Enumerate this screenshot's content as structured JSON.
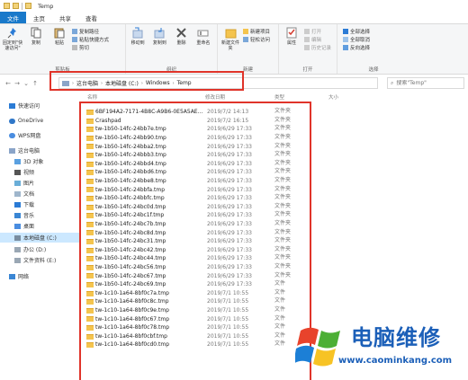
{
  "window": {
    "title": "Temp"
  },
  "tabs": [
    "文件",
    "主页",
    "共享",
    "查看"
  ],
  "ribbon": {
    "clipboard": {
      "pin": "固定到\"快速访问\"",
      "copy": "复制",
      "paste": "粘贴",
      "copy_path": "复制路径",
      "paste_shortcut": "粘贴快捷方式",
      "cut": "剪切",
      "label": "剪贴板"
    },
    "organize": {
      "move_to": "移动到",
      "copy_to": "复制到",
      "delete": "删除",
      "rename": "重命名",
      "label": "组织"
    },
    "new": {
      "new_folder": "新建文件夹",
      "new_item": "新建项目",
      "easy_access": "轻松访问",
      "label": "新建"
    },
    "open": {
      "properties": "属性",
      "open": "打开",
      "edit": "编辑",
      "history": "历史记录",
      "label": "打开"
    },
    "select": {
      "select_all": "全部选择",
      "select_none": "全部取消",
      "invert": "反向选择",
      "label": "选择"
    }
  },
  "address": {
    "segments": [
      "这台电脑",
      "本地磁盘 (C:)",
      "Windows",
      "Temp"
    ]
  },
  "search": {
    "placeholder": "搜索\"Temp\""
  },
  "columns": {
    "name": "名称",
    "date": "修改日期",
    "type": "类型",
    "size": "大小"
  },
  "sidebar": {
    "items": [
      {
        "label": "快速访问",
        "icon": "star-icon"
      },
      {
        "label": "OneDrive",
        "icon": "cloud-icon"
      },
      {
        "label": "WPS网盘",
        "icon": "wps-cloud-icon"
      },
      {
        "label": "这台电脑",
        "icon": "computer-icon"
      },
      {
        "label": "3D 对象",
        "icon": "cube-icon"
      },
      {
        "label": "视频",
        "icon": "video-icon"
      },
      {
        "label": "图片",
        "icon": "picture-icon"
      },
      {
        "label": "文档",
        "icon": "document-icon"
      },
      {
        "label": "下载",
        "icon": "download-icon"
      },
      {
        "label": "音乐",
        "icon": "music-icon"
      },
      {
        "label": "桌面",
        "icon": "desktop-icon"
      },
      {
        "label": "本地磁盘 (C:)",
        "icon": "drive-icon"
      },
      {
        "label": "办公 (D:)",
        "icon": "drive-icon"
      },
      {
        "label": "文件资料 (E:)",
        "icon": "drive-icon"
      },
      {
        "label": "网络",
        "icon": "network-icon"
      }
    ]
  },
  "files": [
    {
      "name": "6BF194A2-7171-4B8C-A9B6-0E5A5AE...",
      "date": "2019/7/2 14:13"
    },
    {
      "name": "Crashpad",
      "date": "2019/7/2 16:15"
    },
    {
      "name": "tw-1b50-14fc-24bb7e.tmp",
      "date": "2019/6/29 17:33"
    },
    {
      "name": "tw-1b50-14fc-24bb90.tmp",
      "date": "2019/6/29 17:33"
    },
    {
      "name": "tw-1b50-14fc-24bba2.tmp",
      "date": "2019/6/29 17:33"
    },
    {
      "name": "tw-1b50-14fc-24bbb3.tmp",
      "date": "2019/6/29 17:33"
    },
    {
      "name": "tw-1b50-14fc-24bbd4.tmp",
      "date": "2019/6/29 17:33"
    },
    {
      "name": "tw-1b50-14fc-24bbd6.tmp",
      "date": "2019/6/29 17:33"
    },
    {
      "name": "tw-1b50-14fc-24bbe8.tmp",
      "date": "2019/6/29 17:33"
    },
    {
      "name": "tw-1b50-14fc-24bbfa.tmp",
      "date": "2019/6/29 17:33"
    },
    {
      "name": "tw-1b50-14fc-24bbfc.tmp",
      "date": "2019/6/29 17:33"
    },
    {
      "name": "tw-1b50-14fc-24bc0d.tmp",
      "date": "2019/6/29 17:33"
    },
    {
      "name": "tw-1b50-14fc-24bc1f.tmp",
      "date": "2019/6/29 17:33"
    },
    {
      "name": "tw-1b50-14fc-24bc7b.tmp",
      "date": "2019/6/29 17:33"
    },
    {
      "name": "tw-1b50-14fc-24bc8d.tmp",
      "date": "2019/6/29 17:33"
    },
    {
      "name": "tw-1b50-14fc-24bc31.tmp",
      "date": "2019/6/29 17:33"
    },
    {
      "name": "tw-1b50-14fc-24bc42.tmp",
      "date": "2019/6/29 17:33"
    },
    {
      "name": "tw-1b50-14fc-24bc44.tmp",
      "date": "2019/6/29 17:33"
    },
    {
      "name": "tw-1b50-14fc-24bc56.tmp",
      "date": "2019/6/29 17:33"
    },
    {
      "name": "tw-1b50-14fc-24bc67.tmp",
      "date": "2019/6/29 17:33"
    },
    {
      "name": "tw-1b50-14fc-24bc69.tmp",
      "date": "2019/6/29 17:33"
    },
    {
      "name": "tw-1c10-1a64-8bf0c7a.tmp",
      "date": "2019/7/1 10:55"
    },
    {
      "name": "tw-1c10-1a64-8bf0c8c.tmp",
      "date": "2019/7/1 10:55"
    },
    {
      "name": "tw-1c10-1a64-8bf0c9e.tmp",
      "date": "2019/7/1 10:55"
    },
    {
      "name": "tw-1c10-1a64-8bf0c67.tmp",
      "date": "2019/7/1 10:55"
    },
    {
      "name": "tw-1c10-1a64-8bf0c78.tmp",
      "date": "2019/7/1 10:55"
    },
    {
      "name": "tw-1c10-1a64-8bf0cbf.tmp",
      "date": "2019/7/1 10:55"
    },
    {
      "name": "tw-1c10-1a64-8bf0cd0.tmp",
      "date": "2019/7/1 10:55"
    }
  ],
  "types": [
    "文件夹",
    "文件夹",
    "文件夹",
    "文件夹",
    "文件夹",
    "文件夹",
    "文件夹",
    "文件夹",
    "文件夹",
    "文件夹",
    "文件夹",
    "文件夹",
    "文件夹",
    "文件夹",
    "文件夹",
    "文件夹",
    "文件夹",
    "文件夹",
    "文件夹",
    "文件夹",
    "文件",
    "文件",
    "文件",
    "文件",
    "文件",
    "文件",
    "文件",
    "文件"
  ],
  "watermark": {
    "title": "电脑维修",
    "url": "www.caominkang.com"
  }
}
